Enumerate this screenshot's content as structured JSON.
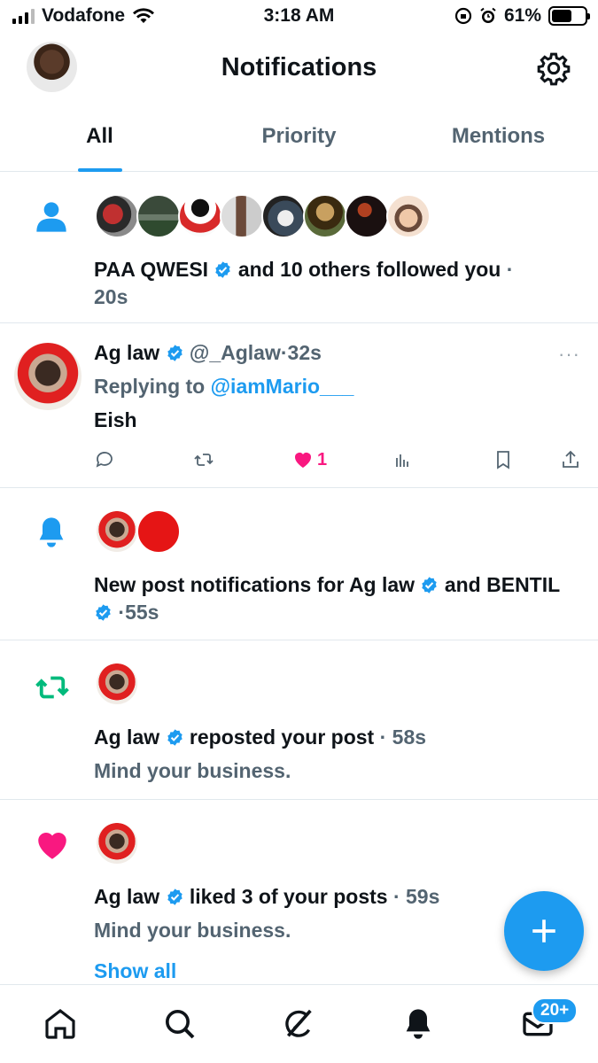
{
  "status_bar": {
    "carrier": "Vodafone",
    "time": "3:18 AM",
    "battery": "61%",
    "battery_level": 0.61
  },
  "header": {
    "title": "Notifications",
    "avatar_icon": "profile-avatar",
    "settings_icon": "gear-icon"
  },
  "tabs": [
    {
      "label": "All",
      "active": true
    },
    {
      "label": "Priority",
      "active": false
    },
    {
      "label": "Mentions",
      "active": false
    }
  ],
  "notifications": [
    {
      "kind": "follow",
      "icon": "person-icon",
      "name": "PAA QWESI",
      "action": "and 10 others followed you",
      "sep": "·",
      "time": "20s"
    },
    {
      "kind": "tweet",
      "name": "Ag law",
      "handle": "@_Aglaw",
      "sep": "·",
      "time": "32s",
      "replying_prefix": "Replying to",
      "replying_to": "@iamMario___",
      "text": "Eish",
      "likes": "1",
      "more": "···"
    },
    {
      "kind": "new-post",
      "icon": "bell-icon",
      "prefix": "New post notifications for",
      "name1": "Ag law",
      "and": "and",
      "name2": "BENTIL",
      "sep": "·",
      "time": "55s"
    },
    {
      "kind": "repost",
      "icon": "repost-icon",
      "name": "Ag law",
      "action": "reposted your post",
      "sep": "·",
      "time": "58s",
      "quote": "Mind your business."
    },
    {
      "kind": "like",
      "icon": "heart-icon",
      "name": "Ag law",
      "action": "liked 3 of your posts",
      "sep": "·",
      "time": "59s",
      "quote": "Mind your business.",
      "show_all": "Show all"
    }
  ],
  "tabbar": {
    "badge": "20+"
  },
  "colors": {
    "accent": "#1d9bf0",
    "like": "#f91880",
    "repost": "#00ba7c",
    "muted": "#536471"
  }
}
